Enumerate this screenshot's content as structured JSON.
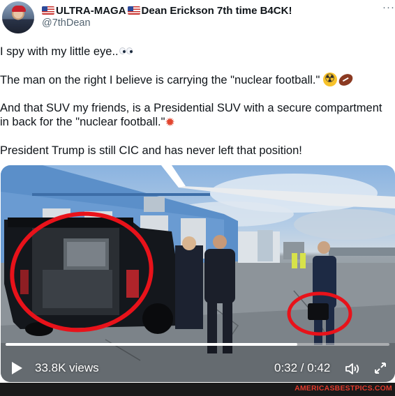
{
  "author": {
    "display_name_1": "ULTRA-MAGA",
    "display_name_2": "Dean Erickson 7th time B4CK!",
    "handle": "@7thDean",
    "avatar_icon": "user-avatar"
  },
  "menu": {
    "more_label": "···"
  },
  "tweet": {
    "para1": "I spy with my little eye..",
    "para2": "The man on the right I believe is carrying the \"nuclear football.\"",
    "para3": "And that SUV my friends, is a Presidential SUV with a secure compartment in back for the \"nuclear football.\"",
    "para4": "President Trump is still CIC and has never left that position!",
    "emojis": [
      "eyes-icon",
      "radioactive-icon",
      "football-icon",
      "collision-icon"
    ]
  },
  "video": {
    "views_label": "33.8K views",
    "time_label": "0:32 / 0:42",
    "progress": 0.76,
    "controls": [
      "play-icon",
      "volume-icon",
      "expand-icon"
    ]
  },
  "watermark": {
    "text": "AMERICASBESTPICS.COM"
  },
  "colors": {
    "text": "#0f1419",
    "secondary": "#536471",
    "annotation": "#e8121a",
    "watermark": "#e23a2c"
  }
}
